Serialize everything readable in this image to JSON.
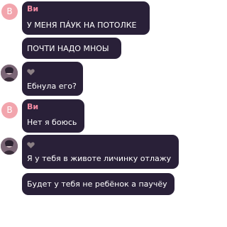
{
  "messages": [
    {
      "author": "Ви",
      "avatar_letter": "В",
      "lines": [
        "У МЕНЯ ПÁУК НА ПОТОЛКЕ",
        "ПОЧТИ НАДО МНОЫ"
      ]
    },
    {
      "author_icon": "heart-icon",
      "avatar": "user-photo",
      "lines": [
        "Ебнула его?"
      ]
    },
    {
      "author": "Ви",
      "avatar_letter": "В",
      "lines": [
        "Нет я боюсь"
      ]
    },
    {
      "author_icon": "heart-icon",
      "avatar": "user-photo",
      "lines": [
        "Я у тебя в животе личинку отлажу",
        "Будет у тебя не ребёнок а паучёу"
      ]
    }
  ],
  "colors": {
    "bubble": "#292038",
    "author_name": "#f28ba3",
    "avatar_letter_bg": "#f2a5ad"
  }
}
